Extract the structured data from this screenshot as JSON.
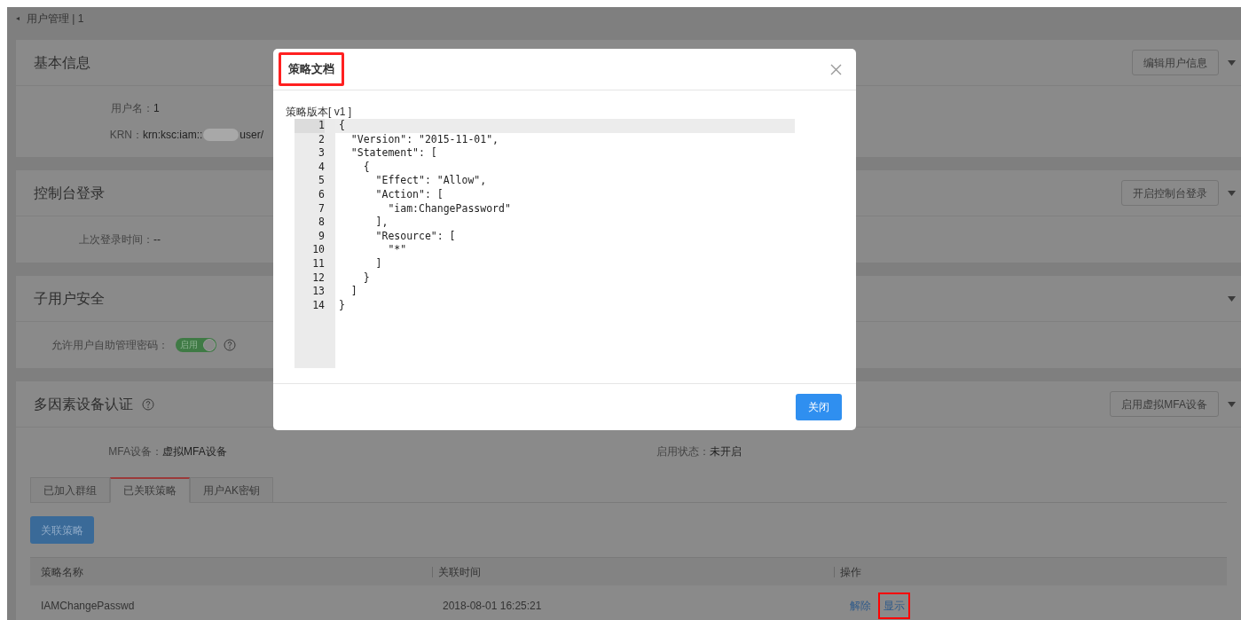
{
  "breadcrumb": {
    "back_icon": "◂",
    "title": "用户管理 | 1"
  },
  "sections": [
    {
      "title": "基本信息",
      "action": "编辑用户信息",
      "fields": [
        {
          "kind": "text",
          "label": "用户名：",
          "value": "1"
        },
        {
          "kind": "redacted",
          "label": "KRN：",
          "value": "krn:ksc:iam::",
          "value_after": "user/"
        }
      ]
    },
    {
      "title": "控制台登录",
      "action": "开启控制台登录",
      "fields": [
        {
          "kind": "text",
          "label": "上次登录时间：",
          "value": "--"
        }
      ]
    },
    {
      "title": "子用户安全",
      "fields": [
        {
          "kind": "switch",
          "label": "允许用户自助管理密码：",
          "switch_label": "启用",
          "on": true,
          "help": true
        }
      ]
    },
    {
      "title": "多因素设备认证",
      "help": true,
      "action": "启用虚拟MFA设备",
      "fields": [
        {
          "kind": "pair",
          "label": "MFA设备：",
          "value": "虚拟MFA设备",
          "label2": "启用状态：",
          "value2": "未开启"
        }
      ]
    }
  ],
  "tabs": [
    {
      "label": "已加入群组",
      "selected": false
    },
    {
      "label": "已关联策略",
      "selected": true
    },
    {
      "label": "用户AK密钥",
      "selected": false
    }
  ],
  "attach_button": "关联策略",
  "table": {
    "columns": [
      "策略名称",
      "关联时间",
      "操作"
    ],
    "rows": [
      {
        "name": "IAMChangePasswd",
        "time": "2018-08-01 16:25:21",
        "actions": [
          {
            "label": "解除",
            "highlighted": false
          },
          {
            "label": "显示",
            "highlighted": true
          }
        ]
      }
    ]
  },
  "modal": {
    "title": "策略文档",
    "title_highlighted": true,
    "version_label": "策略版本[ v1 ]",
    "close_button": "关闭",
    "code": [
      "{",
      "  \"Version\": \"2015-11-01\",",
      "  \"Statement\": [",
      "    {",
      "      \"Effect\": \"Allow\",",
      "      \"Action\": [",
      "        \"iam:ChangePassword\"",
      "      ],",
      "      \"Resource\": [",
      "        \"*\"",
      "      ]",
      "    }",
      "  ]",
      "}"
    ],
    "line_numbers": [
      "1",
      "2",
      "3",
      "4",
      "5",
      "6",
      "7",
      "8",
      "9",
      "10",
      "11",
      "12",
      "13",
      "14"
    ]
  }
}
